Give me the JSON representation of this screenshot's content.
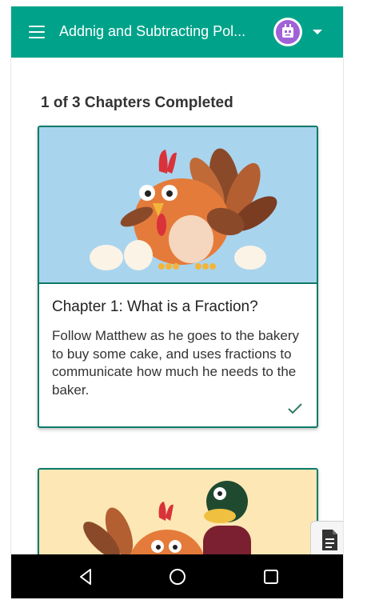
{
  "app_bar": {
    "title": "Addnig and Subtracting Pol...",
    "menu_icon": "hamburger-menu-icon",
    "avatar_icon": "robot-avatar-icon",
    "dropdown_icon": "caret-down-icon",
    "color": "#00a38a"
  },
  "progress": {
    "text": "1 of 3 Chapters Completed"
  },
  "chapters": [
    {
      "title": "Chapter 1: What is a Fraction?",
      "description": "Follow Matthew as he goes to the bakery to buy some cake, and uses fractions to communicate how much he needs to the baker.",
      "completed": true,
      "image": "turkey-with-eggs-illustration"
    },
    {
      "image": "turkey-and-duck-illustration"
    }
  ],
  "floating": {
    "icon": "document-icon"
  },
  "navigation": {
    "back_icon": "back-triangle-icon",
    "home_icon": "home-circle-icon",
    "recents_icon": "recents-square-icon"
  },
  "colors": {
    "accent": "#00a38a",
    "card_border": "#0b7a68",
    "card1_bg": "#a9d4ee",
    "card2_bg": "#fde7b5"
  }
}
